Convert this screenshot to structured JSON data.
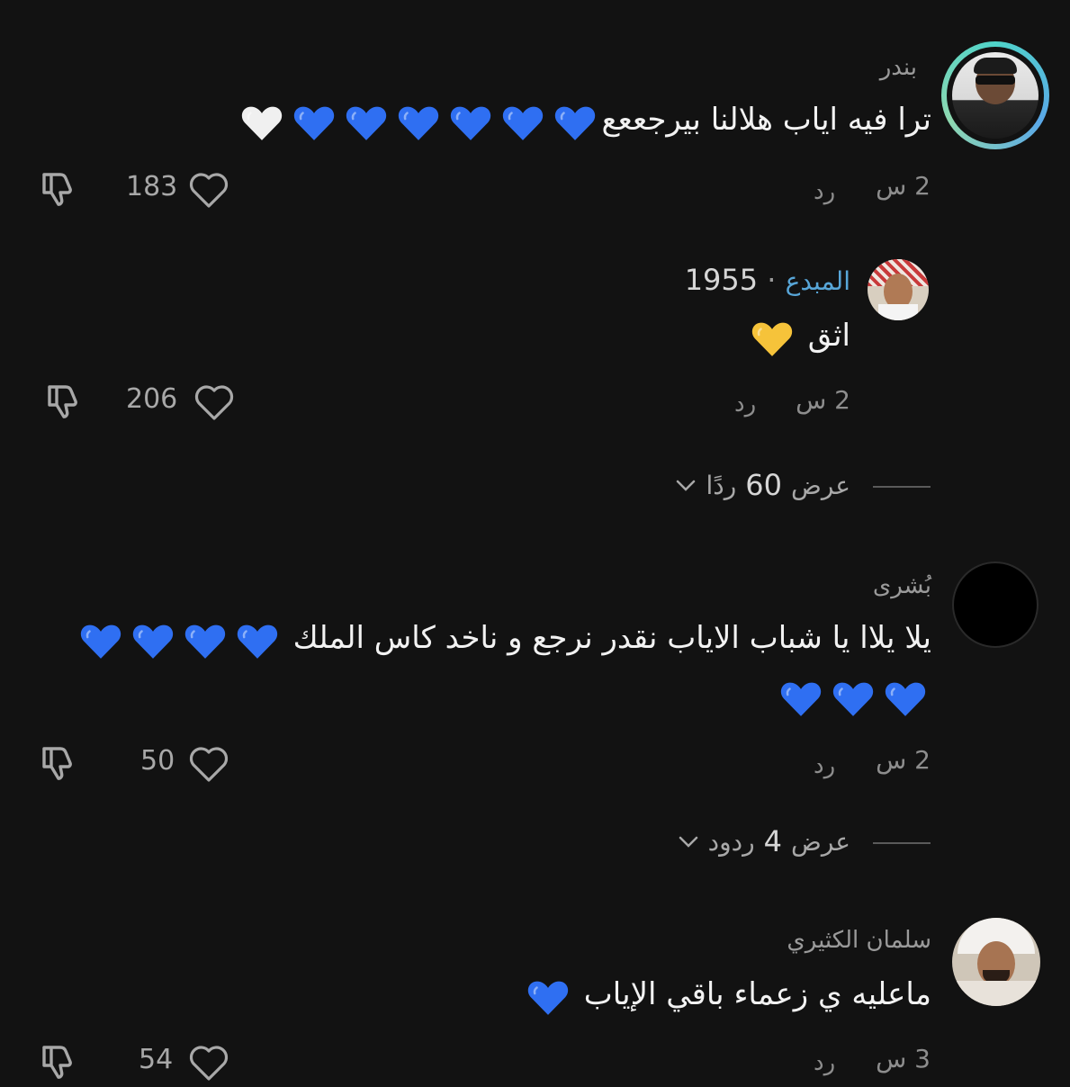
{
  "comments": [
    {
      "username": "بندر",
      "text": "ترا فيه اياب هلالنا بيرجععع",
      "emoji_hearts": [
        "blue",
        "blue",
        "blue",
        "blue",
        "blue",
        "blue",
        "white"
      ],
      "time": "2 س",
      "reply_label": "رد",
      "likes": "183"
    },
    {
      "username_prefix": "1955",
      "username_dot": "·",
      "creator_badge": "المبدع",
      "text": "اثق",
      "emoji_hearts": [
        "yellow"
      ],
      "time": "2 س",
      "reply_label": "رد",
      "likes": "206",
      "view_replies": {
        "prefix": "عرض",
        "count": "60",
        "suffix": "ردًا"
      }
    },
    {
      "username": "بُشرى",
      "text": "يلا يلاا يا شباب الاياب نقدر نرجع و ناخد كاس الملك",
      "emoji_hearts_line1": [
        "blue",
        "blue",
        "blue",
        "blue"
      ],
      "emoji_hearts_line2": [
        "blue",
        "blue",
        "blue"
      ],
      "time": "2 س",
      "reply_label": "رد",
      "likes": "50",
      "view_replies": {
        "prefix": "عرض",
        "count": "4",
        "suffix": "ردود"
      }
    },
    {
      "username": "سلمان الكثيري",
      "text": "ماعليه ي زعماء باقي الإياب",
      "emoji_hearts": [
        "blue"
      ],
      "time": "3 س",
      "reply_label": "رد",
      "likes": "54"
    }
  ],
  "colors": {
    "background": "#121212",
    "blue_heart": "#2f6ff2",
    "white_heart": "#f0f0f0",
    "yellow_heart": "#f6c33a",
    "creator_badge": "#58a6d8"
  },
  "icons": [
    "heart-outline-icon",
    "thumbs-down-icon",
    "chevron-down-icon",
    "avatar"
  ]
}
